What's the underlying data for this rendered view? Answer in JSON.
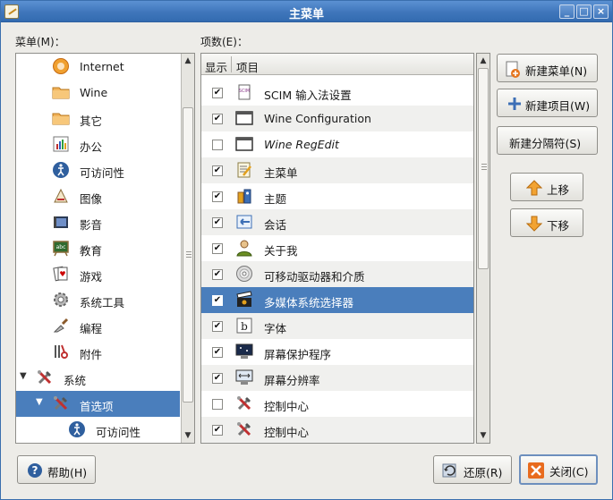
{
  "window": {
    "title": "主菜单"
  },
  "menus_label": "菜单(M)：",
  "items_label": "项数(E)：",
  "menu_tree": [
    {
      "label": "Internet",
      "icon": "globe-icon",
      "level": 1
    },
    {
      "label": "Wine",
      "icon": "folder-icon",
      "level": 1
    },
    {
      "label": "其它",
      "icon": "folder-icon",
      "level": 1
    },
    {
      "label": "办公",
      "icon": "office-chart-icon",
      "level": 1
    },
    {
      "label": "可访问性",
      "icon": "accessibility-icon",
      "level": 1
    },
    {
      "label": "图像",
      "icon": "graphics-icon",
      "level": 1
    },
    {
      "label": "影音",
      "icon": "multimedia-icon",
      "level": 1
    },
    {
      "label": "教育",
      "icon": "education-icon",
      "level": 1
    },
    {
      "label": "游戏",
      "icon": "cards-icon",
      "level": 1
    },
    {
      "label": "系统工具",
      "icon": "gear-icon",
      "level": 1
    },
    {
      "label": "编程",
      "icon": "trowel-icon",
      "level": 1
    },
    {
      "label": "附件",
      "icon": "accessories-icon",
      "level": 1
    },
    {
      "label": "系统",
      "icon": "tools-icon",
      "level": 0,
      "expanded": true
    },
    {
      "label": "首选项",
      "icon": "tools-icon",
      "level": 1,
      "expanded": true,
      "selected": true
    },
    {
      "label": "可访问性",
      "icon": "accessibility-icon",
      "level": 2
    }
  ],
  "columns": {
    "show": "显示",
    "item": "项目"
  },
  "items": [
    {
      "label": "SCIM 输入法设置",
      "checked": true,
      "icon": "scim-icon",
      "italic": false
    },
    {
      "label": "Wine Configuration",
      "checked": true,
      "icon": "window-icon",
      "italic": false
    },
    {
      "label": "Wine RegEdit",
      "checked": false,
      "icon": "window-icon",
      "italic": true
    },
    {
      "label": "主菜单",
      "checked": true,
      "icon": "menu-editor-icon",
      "italic": false
    },
    {
      "label": "主题",
      "checked": true,
      "icon": "theme-icon",
      "italic": false
    },
    {
      "label": "会话",
      "checked": true,
      "icon": "session-icon",
      "italic": false
    },
    {
      "label": "关于我",
      "checked": true,
      "icon": "about-me-icon",
      "italic": false
    },
    {
      "label": "可移动驱动器和介质",
      "checked": true,
      "icon": "cd-icon",
      "italic": false
    },
    {
      "label": "多媒体系统选择器",
      "checked": true,
      "icon": "clapper-icon",
      "italic": false,
      "selected": true
    },
    {
      "label": "字体",
      "checked": true,
      "icon": "font-icon",
      "italic": false
    },
    {
      "label": "屏幕保护程序",
      "checked": true,
      "icon": "screensaver-icon",
      "italic": false
    },
    {
      "label": "屏幕分辨率",
      "checked": true,
      "icon": "resolution-icon",
      "italic": false
    },
    {
      "label": "控制中心",
      "checked": false,
      "icon": "tools-icon",
      "italic": false
    },
    {
      "label": "控制中心",
      "checked": true,
      "icon": "tools-icon",
      "italic": false
    }
  ],
  "buttons": {
    "new_menu": "新建菜单(N)",
    "new_item": "新建项目(W)",
    "new_separator": "新建分隔符(S)",
    "move_up": "上移",
    "move_down": "下移",
    "help": "帮助(H)",
    "revert": "还原(R)",
    "close": "关闭(C)"
  },
  "colors": {
    "selection": "#4a7ebc",
    "titlebar": "#3f76bb"
  }
}
